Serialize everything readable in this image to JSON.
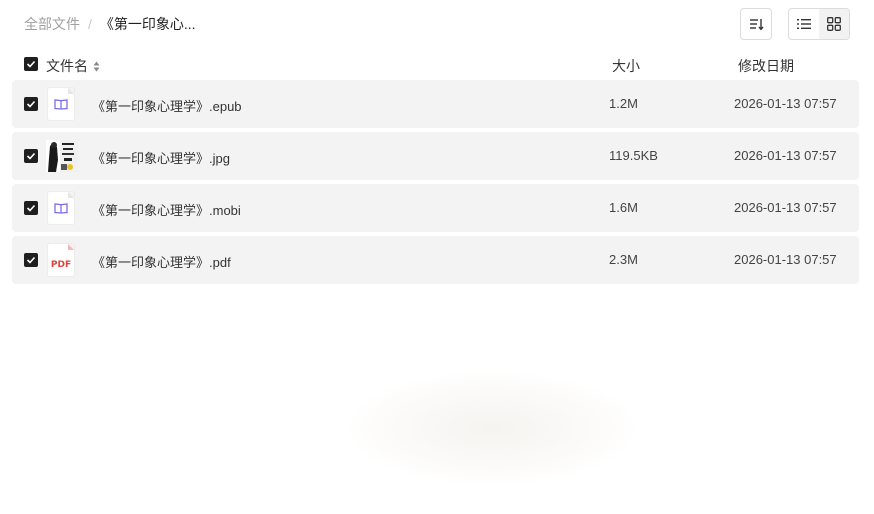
{
  "breadcrumb": {
    "root": "全部文件",
    "separator": "/",
    "current": "《第一印象心..."
  },
  "toolbar": {
    "sort_icon": "sort-icon",
    "list_view_icon": "list-view-icon",
    "grid_view_icon": "grid-view-icon",
    "active_view": "list"
  },
  "table_header": {
    "name": "文件名",
    "size": "大小",
    "date": "修改日期",
    "select_all_checked": true
  },
  "files": [
    {
      "name": "《第一印象心理学》.epub",
      "size": "1.2M",
      "date": "2026-01-13 07:57",
      "type": "epub",
      "checked": true
    },
    {
      "name": "《第一印象心理学》.jpg",
      "size": "119.5KB",
      "date": "2026-01-13 07:57",
      "type": "jpg",
      "checked": true
    },
    {
      "name": "《第一印象心理学》.mobi",
      "size": "1.6M",
      "date": "2026-01-13 07:57",
      "type": "mobi",
      "checked": true
    },
    {
      "name": "《第一印象心理学》.pdf",
      "size": "2.3M",
      "date": "2026-01-13 07:57",
      "type": "pdf",
      "pdf_label": "PDF",
      "checked": true
    }
  ],
  "colors": {
    "ebook_icon": "#7b6ee6",
    "pdf_icon": "#e0403a",
    "row_bg": "#f3f3f3",
    "checkbox": "#1f1f1f"
  }
}
